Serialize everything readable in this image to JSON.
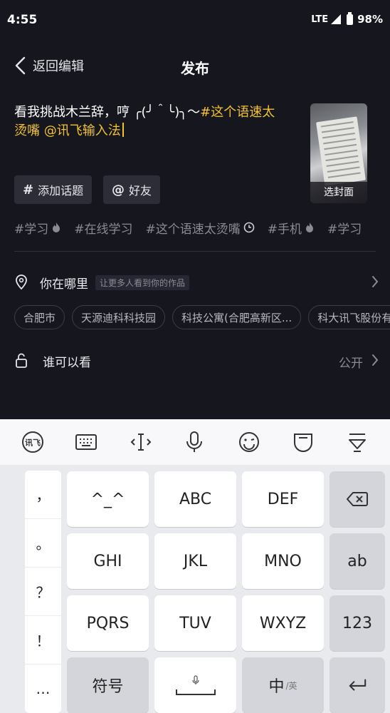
{
  "status": {
    "time": "4:55",
    "network": "LTE",
    "battery": "98%"
  },
  "header": {
    "back_label": "返回编辑",
    "title": "发布"
  },
  "caption": {
    "text_plain": "看我挑战木兰辞，哼 ╭(╯＾╰)╮～",
    "text_highlight": "#这个语速太烫嘴 @讯飞输入法"
  },
  "cover": {
    "label": "选封面"
  },
  "buttons": {
    "topic_symbol": "#",
    "topic_label": "添加话题",
    "friends_symbol": "@",
    "friends_label": "好友"
  },
  "hashtags": [
    {
      "text": "#学习",
      "icon": "fire-icon"
    },
    {
      "text": "#在线学习",
      "icon": ""
    },
    {
      "text": "#这个语速太烫嘴",
      "icon": "clock-icon"
    },
    {
      "text": "#手机",
      "icon": "fire-icon"
    },
    {
      "text": "#学习",
      "icon": ""
    }
  ],
  "location": {
    "label": "你在哪里",
    "hint": "让更多人看到你的作品"
  },
  "places": [
    "合肥市",
    "天源迪科科技园",
    "科技公寓(合肥高新区...",
    "科大讯飞股份有"
  ],
  "visibility": {
    "label": "谁可以看",
    "value": "公开"
  },
  "keyboard": {
    "punctuation": [
      "，",
      "。",
      "？",
      "！",
      "…"
    ],
    "rows": [
      [
        "^_^",
        "ABC",
        "DEF"
      ],
      [
        "GHI",
        "JKL",
        "MNO",
        "ab"
      ],
      [
        "PQRS",
        "TUV",
        "WXYZ",
        "123"
      ]
    ],
    "bottom": {
      "symbol": "符号",
      "lang_main": "中",
      "lang_alt": "/英"
    },
    "logo_text": "讯飞"
  },
  "colors": {
    "background": "#16161f",
    "accent": "#f2c230",
    "keyboard": "#e9eaee"
  }
}
